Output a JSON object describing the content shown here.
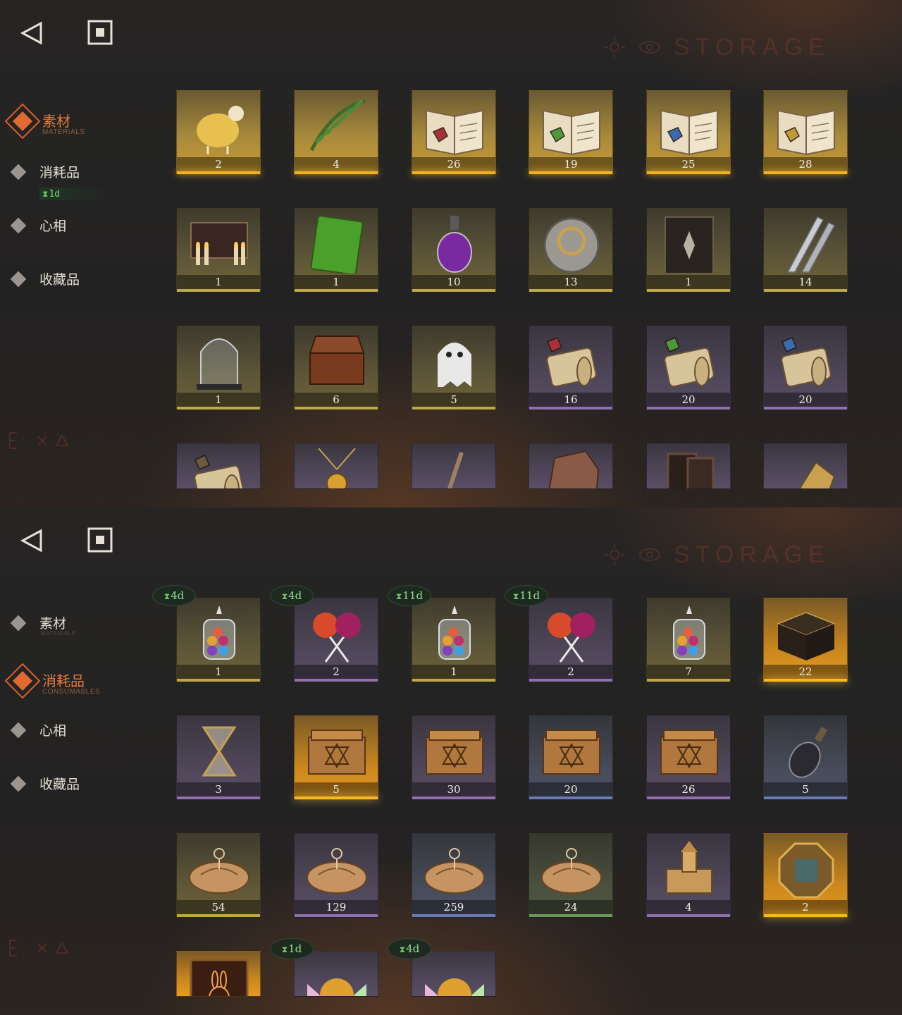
{
  "watermark": "STORAGE",
  "top_panel": {
    "categories": [
      {
        "label": "素材",
        "sublabel": "MATERIALS",
        "active": true
      },
      {
        "label": "消耗品",
        "sublabel": "",
        "active": false
      },
      {
        "label": "心相",
        "sublabel": "",
        "active": false
      },
      {
        "label": "收藏品",
        "sublabel": "",
        "active": false
      }
    ],
    "category_timer": "1d",
    "items": [
      {
        "name": "golden-sheep",
        "count": "2",
        "rarity": "gold"
      },
      {
        "name": "olive-wreath",
        "count": "4",
        "rarity": "gold"
      },
      {
        "name": "book-red",
        "count": "26",
        "rarity": "gold"
      },
      {
        "name": "book-green",
        "count": "19",
        "rarity": "gold"
      },
      {
        "name": "book-blue",
        "count": "25",
        "rarity": "gold"
      },
      {
        "name": "book-gold",
        "count": "28",
        "rarity": "gold"
      },
      {
        "name": "ouija-board",
        "count": "1",
        "rarity": "yellow"
      },
      {
        "name": "green-tablet",
        "count": "1",
        "rarity": "yellow"
      },
      {
        "name": "purple-bottle",
        "count": "10",
        "rarity": "yellow"
      },
      {
        "name": "round-lock",
        "count": "13",
        "rarity": "yellow"
      },
      {
        "name": "dark-tome",
        "count": "1",
        "rarity": "yellow"
      },
      {
        "name": "silver-bullets",
        "count": "14",
        "rarity": "yellow"
      },
      {
        "name": "glass-dome",
        "count": "1",
        "rarity": "yellow"
      },
      {
        "name": "hand-box",
        "count": "6",
        "rarity": "yellow"
      },
      {
        "name": "ghost",
        "count": "5",
        "rarity": "yellow"
      },
      {
        "name": "scroll-red",
        "count": "16",
        "rarity": "purple"
      },
      {
        "name": "scroll-green",
        "count": "20",
        "rarity": "purple"
      },
      {
        "name": "scroll-blue",
        "count": "20",
        "rarity": "purple"
      },
      {
        "name": "scroll-partial",
        "count": "",
        "rarity": "purple"
      },
      {
        "name": "amulet-partial",
        "count": "",
        "rarity": "purple"
      },
      {
        "name": "wand-partial",
        "count": "",
        "rarity": "purple"
      },
      {
        "name": "stone-partial",
        "count": "",
        "rarity": "purple"
      },
      {
        "name": "frame-partial",
        "count": "",
        "rarity": "purple"
      },
      {
        "name": "gear-partial",
        "count": "",
        "rarity": "purple"
      }
    ]
  },
  "bottom_panel": {
    "categories": [
      {
        "label": "素材",
        "sublabel": "MATERIALS",
        "active": false
      },
      {
        "label": "消耗品",
        "sublabel": "CONSUMABLES",
        "active": true
      },
      {
        "label": "心相",
        "sublabel": "",
        "active": false
      },
      {
        "label": "收藏品",
        "sublabel": "",
        "active": false
      }
    ],
    "items": [
      {
        "name": "candy-jar",
        "count": "1",
        "rarity": "yellow",
        "timer": "4d"
      },
      {
        "name": "lollipops",
        "count": "2",
        "rarity": "purple",
        "timer": "4d"
      },
      {
        "name": "candy-jar",
        "count": "1",
        "rarity": "yellow",
        "timer": "11d"
      },
      {
        "name": "lollipops",
        "count": "2",
        "rarity": "purple",
        "timer": "11d"
      },
      {
        "name": "candy-jar",
        "count": "7",
        "rarity": "yellow",
        "timer": ""
      },
      {
        "name": "rune-cube",
        "count": "22",
        "rarity": "gold2",
        "timer": ""
      },
      {
        "name": "hourglass",
        "count": "3",
        "rarity": "purple",
        "timer": ""
      },
      {
        "name": "crate",
        "count": "5",
        "rarity": "gold2",
        "timer": ""
      },
      {
        "name": "crate",
        "count": "30",
        "rarity": "purple",
        "timer": ""
      },
      {
        "name": "crate",
        "count": "20",
        "rarity": "blue",
        "timer": ""
      },
      {
        "name": "crate",
        "count": "26",
        "rarity": "purple",
        "timer": ""
      },
      {
        "name": "message-bottle",
        "count": "5",
        "rarity": "blue",
        "timer": ""
      },
      {
        "name": "parcel",
        "count": "54",
        "rarity": "yellow",
        "timer": ""
      },
      {
        "name": "parcel",
        "count": "129",
        "rarity": "purple",
        "timer": ""
      },
      {
        "name": "parcel",
        "count": "259",
        "rarity": "blue",
        "timer": ""
      },
      {
        "name": "parcel",
        "count": "24",
        "rarity": "green",
        "timer": ""
      },
      {
        "name": "sand-castle",
        "count": "4",
        "rarity": "purple",
        "timer": ""
      },
      {
        "name": "octagon-token",
        "count": "2",
        "rarity": "gold2",
        "timer": ""
      },
      {
        "name": "rabbit-frame",
        "count": "",
        "rarity": "gold2",
        "timer": ""
      },
      {
        "name": "wrapped-candy",
        "count": "",
        "rarity": "purple",
        "timer": "1d"
      },
      {
        "name": "wrapped-candy",
        "count": "",
        "rarity": "purple",
        "timer": "4d"
      }
    ]
  }
}
